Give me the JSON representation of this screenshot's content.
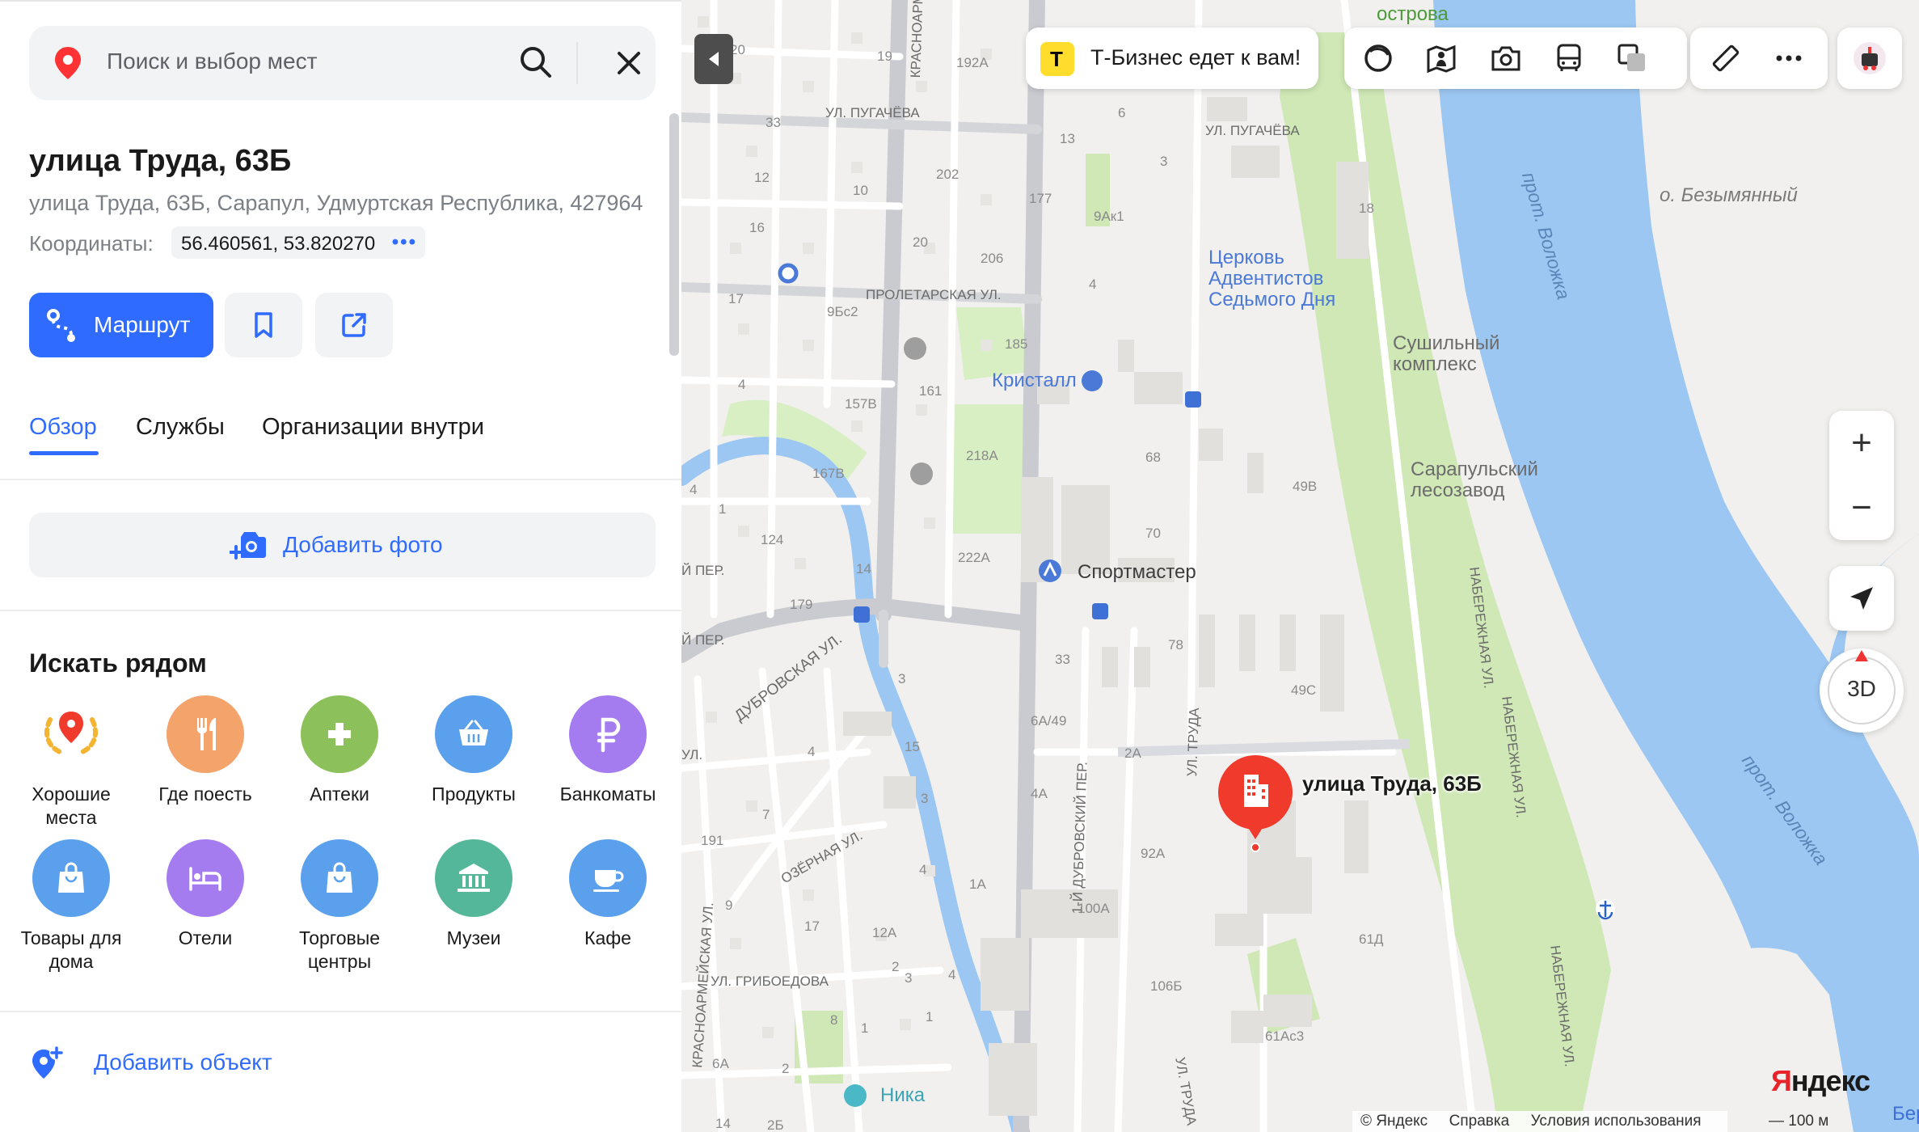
{
  "search": {
    "placeholder": "Поиск и выбор мест"
  },
  "place": {
    "title": "улица Труда, 63Б",
    "address": "улица Труда, 63Б, Сарапул, Удмуртская Республика, 427964",
    "coords_label": "Координаты:",
    "coords_value": "56.460561, 53.820270",
    "coords_more": "•••"
  },
  "actions": {
    "route_label": "Маршрут"
  },
  "tabs": [
    "Обзор",
    "Службы",
    "Организации внутри"
  ],
  "add_photo": "Добавить фото",
  "nearby": {
    "title": "Искать рядом",
    "items": [
      {
        "label": "Хорошие\nместа",
        "icon": "laurel-pin-icon",
        "color": "#ffffff"
      },
      {
        "label": "Где поесть",
        "icon": "fork-knife-icon",
        "color": "#f4a36a"
      },
      {
        "label": "Аптеки",
        "icon": "pharmacy-cross-icon",
        "color": "#8cc05b"
      },
      {
        "label": "Продукты",
        "icon": "basket-icon",
        "color": "#5aa0ec"
      },
      {
        "label": "Банкоматы",
        "icon": "ruble-icon",
        "color": "#a57cf0"
      },
      {
        "label": "Товары для\nдома",
        "icon": "shopping-bag-icon",
        "color": "#5aa0ec"
      },
      {
        "label": "Отели",
        "icon": "bed-icon",
        "color": "#a57cf0"
      },
      {
        "label": "Торговые\nцентры",
        "icon": "shopping-bag-icon",
        "color": "#5aa0ec"
      },
      {
        "label": "Музеи",
        "icon": "museum-icon",
        "color": "#55b79a"
      },
      {
        "label": "Кафе",
        "icon": "coffee-cup-icon",
        "color": "#5aa0ec"
      }
    ]
  },
  "add_object": "Добавить объект",
  "map": {
    "promo": "Т-Бизнес едет к вам!",
    "promo_logo": "T",
    "marker_label": "улица Труда, 63Б",
    "zoom_in": "+",
    "zoom_out": "−",
    "btn_3d": "3D",
    "logo_text": "Яндекс",
    "logo_first": "Я",
    "footer": [
      "© Яндекс",
      "Справка",
      "Условия использования"
    ],
    "scale": "100 м",
    "pois": {
      "church": "Церковь\nАдвентистов\nСедьмого Дня",
      "dryer": "Сушильный\nкомплекс",
      "kristall": "Кристалл",
      "sawmill": "Сарапульский\nлесозавод",
      "sportmaster": "Спортмастер",
      "nika": "Ника",
      "island_top": "острова",
      "island": "о. Безымянный",
      "channel1": "прот. Воложка",
      "channel2": "прот. Воложка",
      "corner_ber": "Бер"
    },
    "streets": {
      "pugacheva1": "УЛ. ПУГАЧЁВА",
      "pugacheva2": "УЛ. ПУГАЧЁВА",
      "krasnoarm": "КРАСНОАРМЕЙСКАЯ УЛ.",
      "proletarskaya": "ПРОЛЕТАРСКАЯ УЛ.",
      "dubrovskaya": "ДУБРОВСКАЯ УЛ.",
      "ozernaya": "ОЗЁРНАЯ УЛ.",
      "dubrovsky_per": "1-Й ДУБРОВСКИЙ ПЕР.",
      "truda1": "УЛ. ТРУДА",
      "truda2": "УЛ. ТРУДА",
      "naberezhnaya1": "НАБЕРЕЖНАЯ УЛ.",
      "naberezhnaya2": "НАБЕРЕЖНАЯ УЛ.",
      "naberezhnaya3": "НАБЕРЕЖНАЯ УЛ.",
      "griboedova": "УЛ. ГРИБОЕДОВА",
      "krasnoarm2": "КРАСНОАРМЕЙСКАЯ УЛ.",
      "per1": "Й ПЕР.",
      "per2": "Й ПЕР.",
      "ul": "УЛ."
    },
    "house_numbers": [
      "20",
      "19",
      "192А",
      "33",
      "12",
      "10",
      "202",
      "177",
      "16",
      "20",
      "206",
      "9Ак1",
      "6",
      "13",
      "3",
      "18",
      "17",
      "9Бс2",
      "4",
      "185",
      "157В",
      "161",
      "4",
      "1",
      "167В",
      "218А",
      "68",
      "49В",
      "124",
      "14",
      "179",
      "222А",
      "70",
      "3",
      "33",
      "78",
      "4",
      "15",
      "6А/49",
      "2А",
      "49С",
      "7",
      "3",
      "4А",
      "191",
      "4",
      "1А",
      "92А",
      "100А",
      "9",
      "17",
      "12А",
      "61Д",
      "8",
      "1",
      "106Б",
      "61Ас3",
      "6А",
      "2",
      "14",
      "2Б",
      "3",
      "1",
      "4",
      "2",
      "4"
    ]
  }
}
